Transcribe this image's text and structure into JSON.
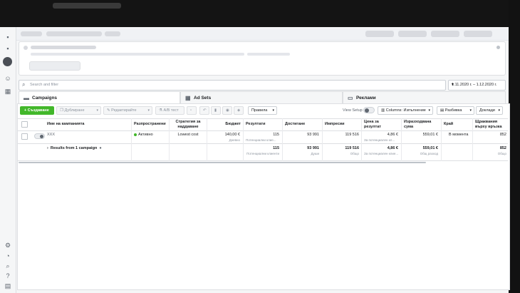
{
  "toolbar": {
    "create_label": "+ Създаване",
    "duplicate_label": "Дублиране",
    "edit_label": "Редактирайте",
    "ab_test_label": "A/B тест",
    "rules_label": "Правила",
    "view_setup_label": "View Setup",
    "columns_label": "Columns: Изпълнение",
    "breakdown_label": "Разбивка",
    "reports_label": "Доклади"
  },
  "search": {
    "placeholder": "Search and filter"
  },
  "date_range": "1.11.2020 г. – 1.12.2020 г.",
  "tabs": [
    {
      "label": "Campaigns",
      "icon": "folder-icon"
    },
    {
      "label": "Ad Sets",
      "icon": "grid-icon"
    },
    {
      "label": "Реклами",
      "icon": "ad-icon"
    }
  ],
  "table": {
    "headers": {
      "name": "Име на кампанията",
      "delivery": "Разпространени",
      "bid": "Стратегия за наддаване",
      "budget": "Бюджет",
      "results": "Резултати",
      "reach": "Достигане",
      "impressions": "Импресии",
      "cost_per_result": "Цена за резултат",
      "spent": "Изразходвана сума",
      "ends": "Край",
      "link_clicks": "Щраквания върху връзка"
    },
    "row": {
      "name": "XXX",
      "delivery": "Активно",
      "bid": "Lowest cost",
      "budget": "140,00 €",
      "budget_sub": "Дневно",
      "results": "115",
      "results_sub": "Потенциални клие...",
      "reach": "93 991",
      "impressions": "119 516",
      "cost_per_result": "4,86 €",
      "cost_sub": "За потенциален кл...",
      "spent": "559,01 €",
      "ends": "В момента",
      "link_clicks": "852"
    },
    "summary": {
      "label": "Results from 1 campaign",
      "results": "115",
      "results_sub": "Потенциални клиенти",
      "reach": "93 991",
      "reach_sub": "Души",
      "impressions": "119 516",
      "impressions_sub": "Общо",
      "cost_per_result": "4,86 €",
      "cost_sub": "За потенциален клие...",
      "spent": "559,01 €",
      "spent_sub": "Общ разход",
      "link_clicks": "852",
      "link_sub": "Общо"
    }
  },
  "colors": {
    "accent_green": "#42b72a",
    "border": "#dddfe2"
  }
}
